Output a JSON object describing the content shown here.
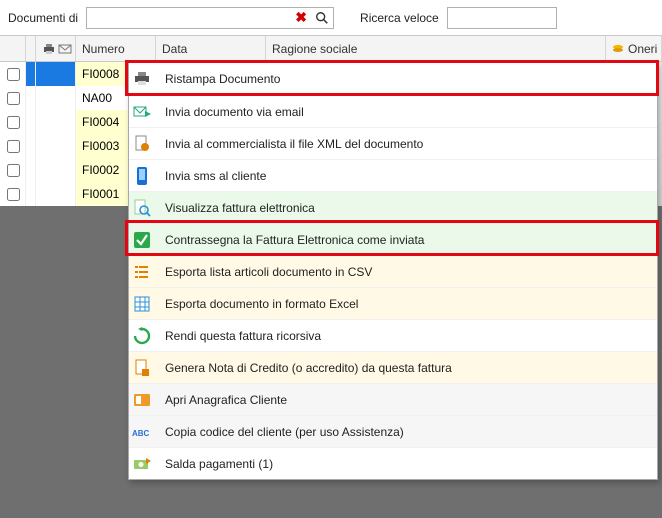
{
  "toolbar": {
    "documenti_label": "Documenti di",
    "ricerca_label": "Ricerca veloce",
    "search_value": "",
    "quick_value": ""
  },
  "headers": {
    "numero": "Numero",
    "data": "Data",
    "ragione": "Ragione sociale",
    "oneri": "Oneri"
  },
  "rows": [
    {
      "num": "FI0008",
      "selected": true,
      "na": false
    },
    {
      "num": "NA00",
      "selected": false,
      "na": true
    },
    {
      "num": "FI0004",
      "selected": false,
      "na": false
    },
    {
      "num": "FI0003",
      "selected": false,
      "na": false
    },
    {
      "num": "FI0002",
      "selected": false,
      "na": false
    },
    {
      "num": "FI0001",
      "selected": false,
      "na": false
    }
  ],
  "ctx": {
    "ristampa": "Ristampa Documento",
    "email": "Invia documento via email",
    "xml": "Invia al commercialista il file XML del documento",
    "sms": "Invia sms al cliente",
    "viewfe": "Visualizza fattura elettronica",
    "mark": "Contrassegna la Fattura Elettronica come inviata",
    "csv": "Esporta lista articoli documento in CSV",
    "xls": "Esporta documento in formato Excel",
    "recur": "Rendi questa fattura ricorsiva",
    "nota": "Genera Nota di Credito (o accredito) da questa fattura",
    "anag": "Apri Anagrafica Cliente",
    "copy": "Copia codice del cliente (per uso Assistenza)",
    "saldo": "Salda pagamenti (1)"
  }
}
